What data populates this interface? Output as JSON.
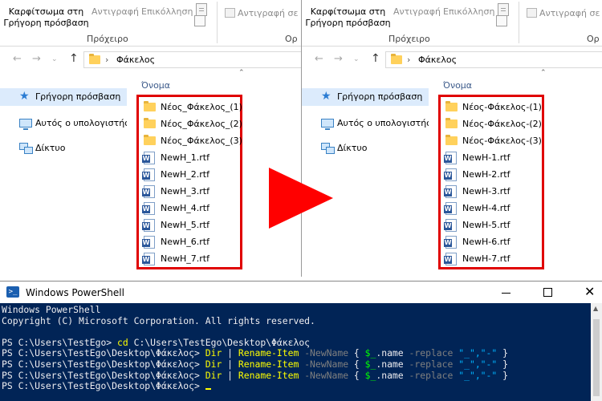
{
  "ribbon": {
    "pin_line1": "Καρφίτσωμα στη",
    "pin_line2": "Γρήγορη πρόσβαση",
    "copy": "Αντιγραφή",
    "paste": "Επικόλληση",
    "copy_to": "Αντιγραφή σε",
    "group_clipboard": "Πρόχειρο",
    "group_organize": "Ορ"
  },
  "nav": {
    "back": "←",
    "forward": "→",
    "dropdown": "⌄",
    "up": "↑",
    "chevron": "›",
    "path": "Φάκελος"
  },
  "navpane": {
    "quick_access": "Γρήγορη πρόσβαση",
    "this_pc": "Αυτός ο υπολογιστής",
    "network": "Δίκτυο"
  },
  "column": {
    "name": "Όνομα",
    "collapse": "⌃"
  },
  "before": {
    "files": [
      {
        "name": "Νέος_Φάκελος_(1)",
        "icon": "folder-icon"
      },
      {
        "name": "Νέος_Φάκελος_(2)",
        "icon": "folder-icon"
      },
      {
        "name": "Νέος_Φάκελος_(3)",
        "icon": "folder-icon"
      },
      {
        "name": "NewH_1.rtf",
        "icon": "document-icon"
      },
      {
        "name": "NewH_2.rtf",
        "icon": "document-icon"
      },
      {
        "name": "NewH_3.rtf",
        "icon": "document-icon"
      },
      {
        "name": "NewH_4.rtf",
        "icon": "document-icon"
      },
      {
        "name": "NewH_5.rtf",
        "icon": "document-icon"
      },
      {
        "name": "NewH_6.rtf",
        "icon": "document-icon"
      },
      {
        "name": "NewH_7.rtf",
        "icon": "document-icon"
      }
    ]
  },
  "after": {
    "files": [
      {
        "name": "Νέος-Φάκελος-(1)",
        "icon": "folder-icon"
      },
      {
        "name": "Νέος-Φάκελος-(2)",
        "icon": "folder-icon"
      },
      {
        "name": "Νέος-Φάκελος-(3)",
        "icon": "folder-icon"
      },
      {
        "name": "NewH-1.rtf",
        "icon": "document-icon"
      },
      {
        "name": "NewH-2.rtf",
        "icon": "document-icon"
      },
      {
        "name": "NewH-3.rtf",
        "icon": "document-icon"
      },
      {
        "name": "NewH-4.rtf",
        "icon": "document-icon"
      },
      {
        "name": "NewH-5.rtf",
        "icon": "document-icon"
      },
      {
        "name": "NewH-6.rtf",
        "icon": "document-icon"
      },
      {
        "name": "NewH-7.rtf",
        "icon": "document-icon"
      }
    ]
  },
  "colors": {
    "highlight_box": "#e00000",
    "arrow": "#ff0000",
    "ps_background": "#012456"
  },
  "powershell": {
    "window_title": "Windows PowerShell",
    "icon": ">_",
    "close": "✕",
    "line1": "Windows PowerShell",
    "line2": "Copyright (C) Microsoft Corporation. All rights reserved.",
    "line3": "",
    "cd_prompt": "PS C:\\Users\\TestEgo> ",
    "cd_cmd": "cd",
    "cd_arg": " C:\\Users\\TestEgo\\Desktop\\Φάκελος",
    "prompt": "PS C:\\Users\\TestEgo\\Desktop\\Φάκελος> ",
    "dir": "Dir",
    "pipe": " | ",
    "rename": "Rename-Item",
    "newname_param": " -NewName ",
    "open_brace": "{ ",
    "var": "$_",
    "name_prop": ".name ",
    "replace_param": "-replace ",
    "args": "\"_\",\"-\"",
    "close_brace": " }",
    "last_prompt": "PS C:\\Users\\TestEgo\\Desktop\\Φάκελος> "
  }
}
